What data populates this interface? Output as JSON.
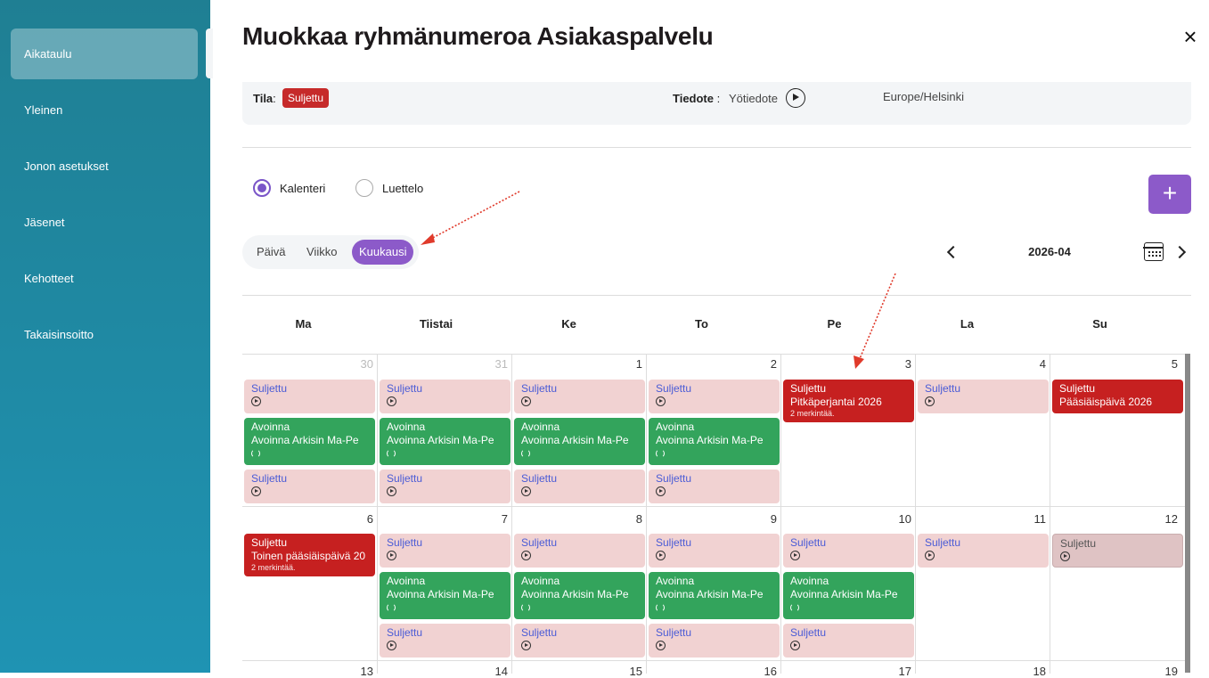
{
  "sidebar": {
    "items": [
      {
        "label": "Aikataulu"
      },
      {
        "label": "Yleinen"
      },
      {
        "label": "Jonon asetukset"
      },
      {
        "label": "Jäsenet"
      },
      {
        "label": "Kehotteet"
      },
      {
        "label": "Takaisinsoitto"
      }
    ]
  },
  "dialog": {
    "title": "Muokkaa ryhmänumeroa Asiakaspalvelu",
    "close_icon": "close-icon"
  },
  "info": {
    "status_label": "Tila",
    "status_colon": ":",
    "status_value": "Suljettu",
    "notice_label": "Tiedote",
    "notice_colon": " :",
    "notice_value": "Yötiedote",
    "timezone": "Europe/Helsinki"
  },
  "mode": {
    "calendar_label": "Kalenteri",
    "list_label": "Luettelo",
    "selected": "Kalenteri"
  },
  "view": {
    "day": "Päivä",
    "week": "Viikko",
    "month": "Kuukausi",
    "active": "Kuukausi"
  },
  "navigation": {
    "month": "2026-04"
  },
  "calendar": {
    "weekdays": [
      "Ma",
      "Tiistai",
      "Ke",
      "To",
      "Pe",
      "La",
      "Su"
    ],
    "weeks": [
      {
        "days": [
          "30",
          "31",
          "1",
          "2",
          "3",
          "4",
          "5"
        ]
      },
      {
        "days": [
          "6",
          "7",
          "8",
          "9",
          "10",
          "11",
          "12"
        ]
      },
      {
        "days": [
          "13",
          "14",
          "15",
          "16",
          "17",
          "18",
          "19"
        ]
      }
    ],
    "labels": {
      "closed": "Suljettu",
      "open": "Avoinna",
      "open_schedule": "Avoinna Arkisin Ma-Pe",
      "good_friday": "Pitkäperjantai 2026",
      "easter": "Pääsiäispäivä 2026",
      "easter_monday": "Toinen pääsiäispäivä 20",
      "entries_2": "2 merkintää."
    }
  },
  "colors": {
    "accent": "#8c5ac9",
    "closed": "#c62020",
    "closed_light": "#f1d2d2",
    "open": "#33a45c",
    "sidebar": "#1f8aa6"
  }
}
